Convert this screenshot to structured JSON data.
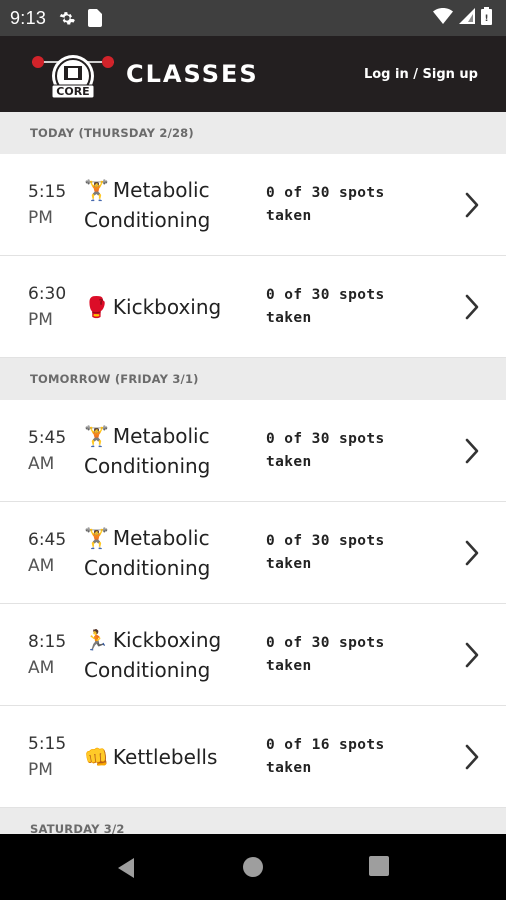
{
  "status": {
    "time": "9:13",
    "icons": [
      "gear-icon",
      "sim-card-icon",
      "wifi-icon",
      "signal-icon",
      "battery-icon"
    ]
  },
  "header": {
    "logo_text": "CORE",
    "title": "CLASSES",
    "login_label": "Log in / Sign up"
  },
  "sections": [
    {
      "label": "TODAY (THURSDAY 2/28)",
      "classes": [
        {
          "time": "5:15",
          "ampm": "PM",
          "emoji": "🏋",
          "name": "Metabolic Conditioning",
          "spots": "0 of 30 spots taken"
        },
        {
          "time": "6:30",
          "ampm": "PM",
          "emoji": "🥊",
          "name": "Kickboxing",
          "spots": "0 of 30 spots taken"
        }
      ]
    },
    {
      "label": "TOMORROW (FRIDAY 3/1)",
      "classes": [
        {
          "time": "5:45",
          "ampm": "AM",
          "emoji": "🏋",
          "name": "Metabolic Conditioning",
          "spots": "0 of 30 spots taken"
        },
        {
          "time": "6:45",
          "ampm": "AM",
          "emoji": "🏋",
          "name": "Metabolic Conditioning",
          "spots": "0 of 30 spots taken"
        },
        {
          "time": "8:15",
          "ampm": "AM",
          "emoji": "🏃",
          "name": "Kickboxing Conditioning",
          "spots": "0 of 30 spots taken"
        },
        {
          "time": "5:15",
          "ampm": "PM",
          "emoji": "👊",
          "name": "Kettlebells",
          "spots": "0 of 16 spots taken"
        }
      ]
    },
    {
      "label": "SATURDAY 3/2",
      "classes": []
    }
  ],
  "nav": {
    "icons": [
      "back-icon",
      "home-icon",
      "recents-icon"
    ]
  },
  "colors": {
    "appbar": "#231f20",
    "statusbar": "#3f3f3f",
    "section_bg": "#ebebeb",
    "logo_red": "#d1232a"
  }
}
